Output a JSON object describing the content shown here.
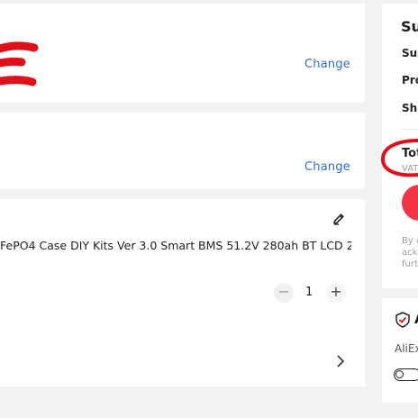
{
  "address_card": {
    "change_label": "Change"
  },
  "payment_card": {
    "change_label": "Change"
  },
  "item_card": {
    "title": "FePO4 Case DIY Kits Ver 3.0 Smart BMS 51.2V 280ah BT LCD 2...",
    "quantity": "1",
    "minus_symbol": "−",
    "plus_symbol": "+"
  },
  "summary": {
    "heading": "Su",
    "subtotal_label": "Sub",
    "promo_label": "Pro",
    "shipping_label": "Shi",
    "total_label": "Tot",
    "vat_label": "VAT",
    "terms_lines": [
      "By c",
      "ackn",
      "furt"
    ]
  },
  "protection": {
    "heading": "A",
    "brand_text": "AliEx"
  },
  "colors": {
    "link": "#2e6fc5",
    "scribble": "#e0101a",
    "place_order": "#f23446"
  }
}
